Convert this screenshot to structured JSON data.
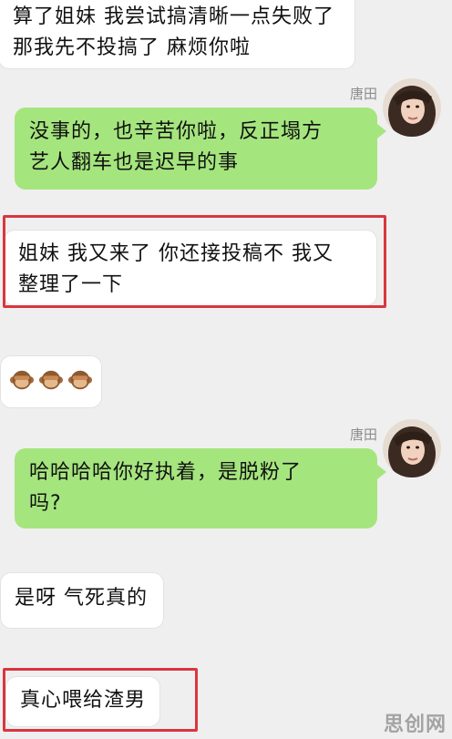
{
  "messages": [
    {
      "text": "算了姐妹 我尝试搞清晰一点失败了\n那我先不投搞了 麻烦你啦"
    },
    {
      "sender": "唐田",
      "text": "没事的，也辛苦你啦，反正塌方\n艺人翻车也是迟早的事"
    },
    {
      "text": "姐妹 我又来了 你还接投稿不 我又\n整理了一下"
    },
    {
      "emoji": "monkey-face-icon"
    },
    {
      "sender": "唐田",
      "text": "哈哈哈哈你好执着，是脱粉了\n吗?"
    },
    {
      "text": "是呀 气死真的"
    },
    {
      "text": "真心喂给渣男"
    }
  ],
  "watermark": "思创网",
  "colors": {
    "background": "#efefef",
    "left_bubble": "#ffffff",
    "right_bubble": "#a5e57e",
    "highlight": "#d9363e"
  }
}
